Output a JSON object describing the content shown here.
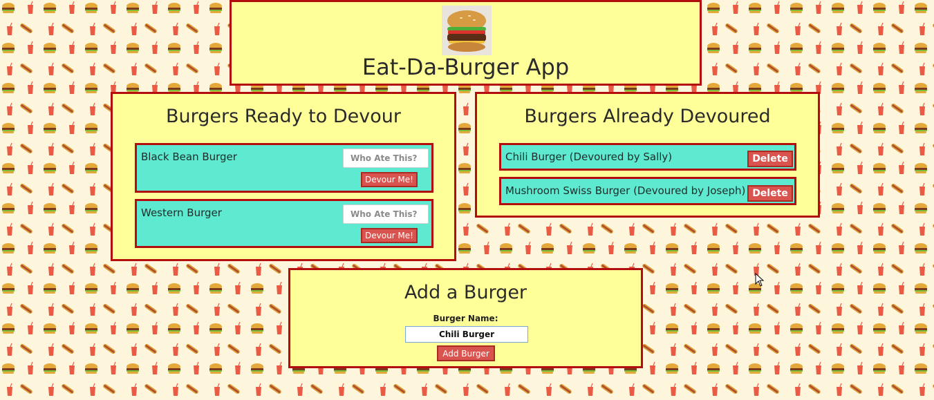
{
  "app": {
    "title": "Eat-Da-Burger App",
    "logo_icon": "burger-photo-icon"
  },
  "ready": {
    "title": "Burgers Ready to Devour",
    "items": [
      {
        "name": "Black Bean Burger",
        "placeholder": "Who Ate This?",
        "button": "Devour Me!"
      },
      {
        "name": "Western Burger",
        "placeholder": "Who Ate This?",
        "button": "Devour Me!"
      }
    ]
  },
  "devoured": {
    "title": "Burgers Already Devoured",
    "items": [
      {
        "text": "Chili Burger (Devoured by Sally)",
        "button": "Delete"
      },
      {
        "text": "Mushroom Swiss Burger (Devoured by Joseph)",
        "button": "Delete"
      }
    ]
  },
  "add": {
    "title": "Add a Burger",
    "label": "Burger Name:",
    "value": "Chili Burger",
    "button": "Add Burger"
  },
  "colors": {
    "panel_bg": "#ffff99",
    "border": "#b30d0d",
    "card_bg": "#5eead1",
    "button": "#d9534f"
  }
}
